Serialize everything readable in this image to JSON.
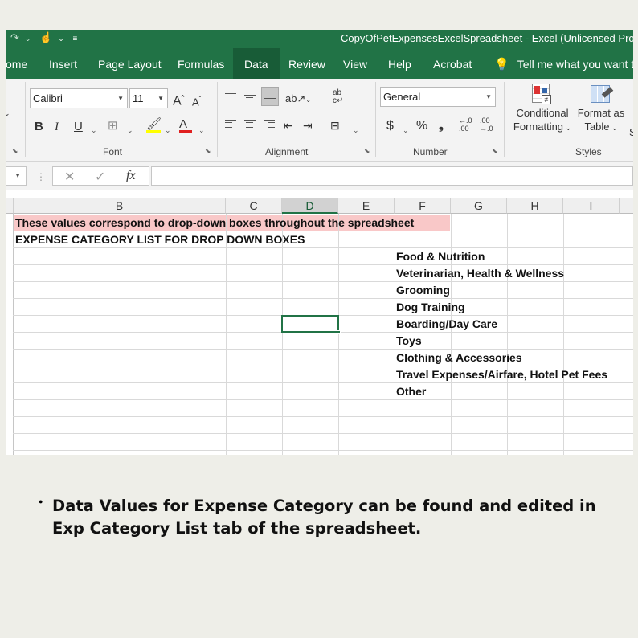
{
  "window": {
    "title": "CopyOfPetExpensesExcelSpreadsheet  -  Excel (Unlicensed Produ",
    "accent": "#217346"
  },
  "tabs": [
    "ome",
    "Insert",
    "Page Layout",
    "Formulas",
    "Data",
    "Review",
    "View",
    "Help",
    "Acrobat"
  ],
  "active_tab": "Data",
  "tell_me": "Tell me what you want to",
  "ribbon": {
    "font": {
      "name": "Calibri",
      "size": "11",
      "grow": "A",
      "shrink": "A",
      "bold": "B",
      "italic": "I",
      "underline": "U",
      "font_color": "A",
      "label": "Font"
    },
    "alignment": {
      "wrap": "ab\nc↵",
      "label": "Alignment"
    },
    "number": {
      "format": "General",
      "currency": "$",
      "percent": "%",
      "comma": "❟",
      "inc_decimal": "←.0\n.00",
      "dec_decimal": ".00\n→.0",
      "label": "Number"
    },
    "styles": {
      "conditional": "Conditional",
      "conditional2": "Formatting",
      "format_as": "Format as",
      "format_as2": "Table",
      "label": "Styles",
      "cut": "S"
    }
  },
  "formula_bar": {
    "fx": "fx",
    "cancel": "✕",
    "enter": "✓",
    "value": ""
  },
  "columns": [
    "B",
    "C",
    "D",
    "E",
    "F",
    "G",
    "H",
    "I"
  ],
  "selected_column": "D",
  "cells": {
    "header_note": "These values correspond to  drop-down boxes throughout the spreadsheet",
    "list_title": "EXPENSE CATEGORY LIST FOR DROP DOWN BOXES",
    "categories": [
      "Food & Nutrition",
      "Veterinarian, Health & Wellness",
      "Grooming",
      "Dog Training",
      "Boarding/Day Care",
      "Toys",
      "Clothing & Accessories",
      "Travel Expenses/Airfare, Hotel Pet Fees",
      "Other"
    ]
  },
  "caption": "Data Values for Expense Category can be found and edited in Exp Category List tab of the spreadsheet."
}
